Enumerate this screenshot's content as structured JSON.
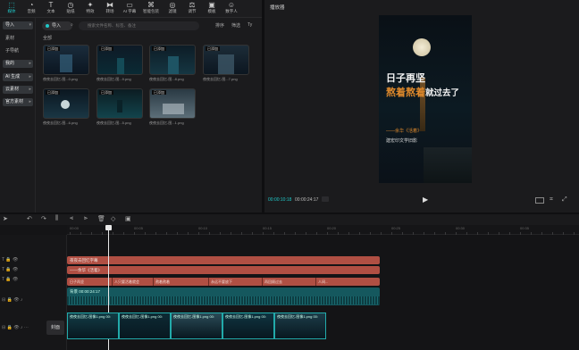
{
  "toolbar": {
    "items": [
      {
        "icon": "import-icon",
        "label": "媒体"
      },
      {
        "icon": "audio-icon",
        "label": "音频"
      },
      {
        "icon": "text-icon",
        "label": "文本"
      },
      {
        "icon": "sticker-icon",
        "label": "贴纸"
      },
      {
        "icon": "effects-icon",
        "label": "特效"
      },
      {
        "icon": "transition-icon",
        "label": "转场"
      },
      {
        "icon": "subtitle-icon",
        "label": "AI 字幕"
      },
      {
        "icon": "smart-package-icon",
        "label": "智能包装"
      },
      {
        "icon": "filter-icon",
        "label": "滤镜"
      },
      {
        "icon": "adjust-icon",
        "label": "调节"
      },
      {
        "icon": "template-icon",
        "label": "模板"
      },
      {
        "icon": "digital-human-icon",
        "label": "数字人"
      }
    ]
  },
  "sidebar": {
    "items": [
      {
        "label": "导入",
        "chevron": true
      },
      {
        "label": "素材"
      },
      {
        "label": "子导航"
      },
      {
        "label": "我的",
        "chevron": true
      },
      {
        "label": "AI 生成",
        "chevron": true
      },
      {
        "label": "云素材",
        "chevron": true
      },
      {
        "label": "官方素材",
        "chevron": true
      }
    ]
  },
  "library": {
    "import_label": "导入",
    "search_placeholder": "搜索文件名称、标签、备注",
    "section_label": "全部",
    "filter_labels": [
      "排序",
      "筛选",
      "Ty"
    ],
    "thumbs": [
      {
        "tag": "已添加",
        "caption": "夜夜去回忆-图...0.png"
      },
      {
        "tag": "已添加",
        "caption": "夜夜去回忆-图...9.png"
      },
      {
        "tag": "已添加",
        "caption": "夜夜去回忆-图...8.png"
      },
      {
        "tag": "已添加",
        "caption": "夜夜去回忆-图...7.png"
      },
      {
        "tag": "已添加",
        "caption": "夜夜去回忆-图...6.png"
      },
      {
        "tag": "已添加",
        "caption": "夜夜去回忆-图...5.png"
      },
      {
        "tag": "已添加",
        "caption": "夜夜去回忆-图...1.png"
      }
    ]
  },
  "player": {
    "title": "播放器",
    "video_line1": "日子再坚",
    "video_line2a": "熬着熬着",
    "video_line2b": "就过去了",
    "video_sub1": "——余华《活着》",
    "video_sub2": "建宏印文学旧影",
    "time_current": "00:00:10:18",
    "time_total": "00:00:24:17",
    "ratio_label": "比例",
    "fullscreen_label": "全屏"
  },
  "timeline": {
    "ruler_labels": [
      "00:00",
      "00:05",
      "00:10",
      "00:15",
      "00:20",
      "00:25",
      "00:30",
      "00:35"
    ],
    "text_track1": "夜夜去回忆字幕",
    "text_track2": "——余华《活着》",
    "segments": [
      "日子再坚",
      "人只要活着就会",
      "熬着熬着",
      "永远不要放下",
      "再回顾过去",
      "人间..."
    ],
    "audio_label": "背景  00:00:24:17",
    "video_clip_label": "夜夜去回忆-图像1.png 00:",
    "cover_label": "封面"
  }
}
